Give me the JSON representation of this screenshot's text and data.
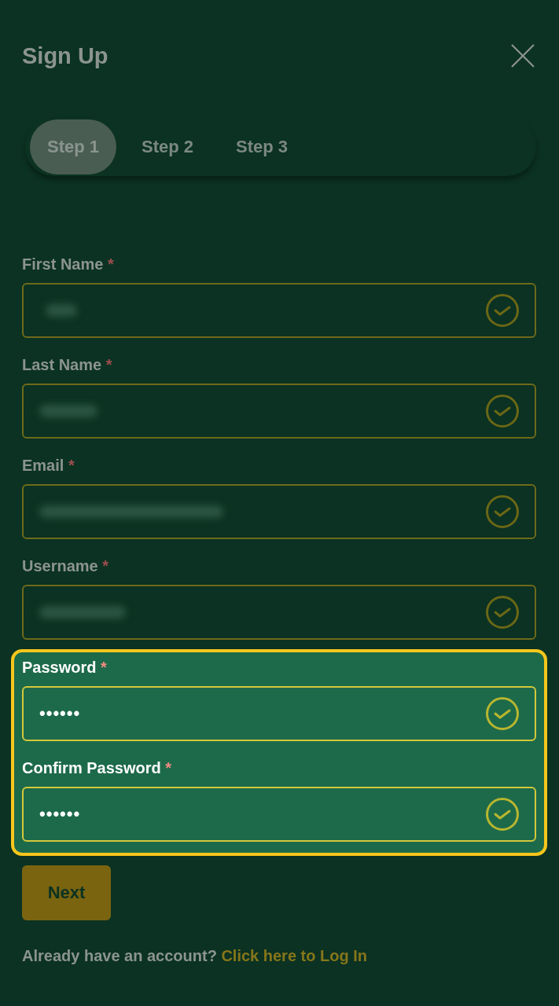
{
  "header": {
    "title": "Sign Up"
  },
  "steps": [
    {
      "label": "Step 1",
      "selected": true
    },
    {
      "label": "Step 2",
      "selected": false
    },
    {
      "label": "Step 3",
      "selected": false
    }
  ],
  "form": {
    "sections": [
      {
        "highlighted": false,
        "fields": [
          {
            "label": "First Name",
            "required_mark": "*",
            "value_blurred": true,
            "valid": true
          },
          {
            "label": "Last Name",
            "required_mark": "*",
            "value_blurred": true,
            "valid": true
          },
          {
            "label": "Email",
            "required_mark": "*",
            "value_blurred": true,
            "valid": true
          },
          {
            "label": "Username",
            "required_mark": "*",
            "value_blurred": true,
            "valid": true
          }
        ]
      },
      {
        "highlighted": true,
        "fields": [
          {
            "label": "Password",
            "required_mark": "*",
            "value": "••••••",
            "value_blurred": false,
            "valid": true
          },
          {
            "label": "Confirm Password",
            "required_mark": "*",
            "value": "••••••",
            "value_blurred": false,
            "valid": true
          }
        ]
      }
    ]
  },
  "next_button": {
    "label": "Next"
  },
  "footer": {
    "prompt": "Already have an account?",
    "link": "Click here to Log In"
  }
}
